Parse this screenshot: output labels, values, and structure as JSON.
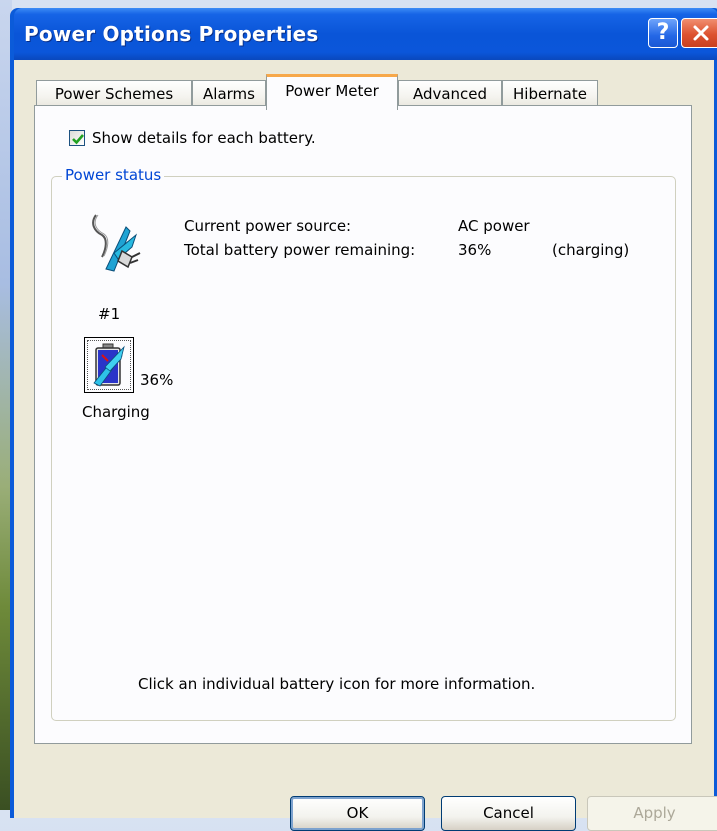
{
  "window": {
    "title": "Power Options Properties",
    "help_glyph": "?",
    "close_glyph": "X"
  },
  "tabs": [
    {
      "label": "Power Schemes",
      "active": false
    },
    {
      "label": "Alarms",
      "active": false
    },
    {
      "label": "Power Meter",
      "active": true
    },
    {
      "label": "Advanced",
      "active": false
    },
    {
      "label": "Hibernate",
      "active": false
    }
  ],
  "options": {
    "show_details_label": "Show details for each battery.",
    "show_details_checked": true
  },
  "power_status": {
    "group_title": "Power status",
    "current_source_label": "Current power source:",
    "current_source_value": "AC power",
    "remaining_label": "Total battery power remaining:",
    "remaining_value": "36%",
    "remaining_state": "(charging)",
    "status_icon": "ac-power-plug-icon"
  },
  "batteries": [
    {
      "number": "#1",
      "percent": "36%",
      "level": 0.36,
      "status": "Charging",
      "icon": "battery-charging-icon"
    }
  ],
  "hint": "Click an individual battery icon for more information.",
  "buttons": {
    "ok": "OK",
    "cancel": "Cancel",
    "apply": "Apply",
    "apply_enabled": false
  },
  "colors": {
    "title_bar": "#0b56da",
    "tab_highlight": "#f7a84a",
    "group_title": "#0046d5",
    "dialog_bg": "#ece9d8"
  }
}
